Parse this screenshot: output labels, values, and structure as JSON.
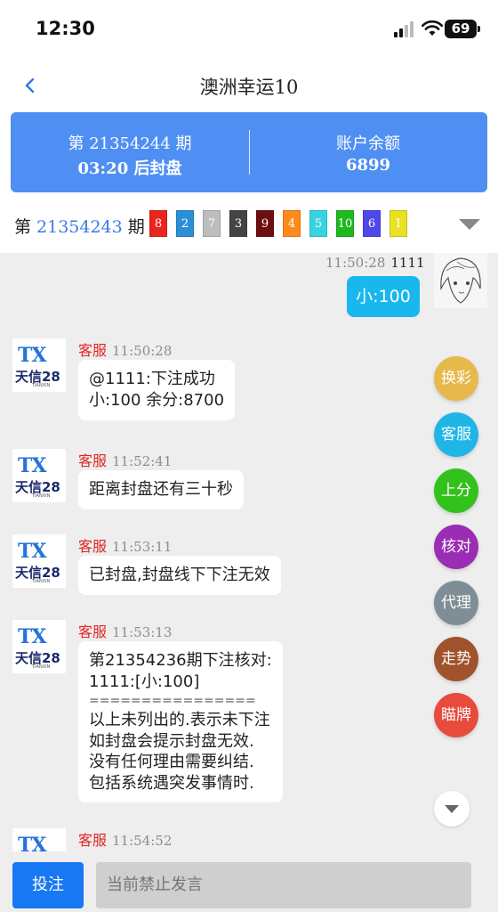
{
  "status": {
    "time": "12:30",
    "battery": "69"
  },
  "nav": {
    "title": "澳洲幸运10"
  },
  "info": {
    "period_label": "第 21354244 期",
    "countdown_label": "03:20 后封盘",
    "balance_title": "账户余额",
    "balance_value": "6899"
  },
  "result": {
    "prefix": "第",
    "period": "21354243",
    "suffix": "期",
    "balls": [
      {
        "n": "8",
        "color": "#e8261e"
      },
      {
        "n": "2",
        "color": "#2a8fd6"
      },
      {
        "n": "7",
        "color": "#bdbdbd"
      },
      {
        "n": "3",
        "color": "#444444"
      },
      {
        "n": "9",
        "color": "#6e0f0f"
      },
      {
        "n": "4",
        "color": "#ff8a1a"
      },
      {
        "n": "5",
        "color": "#38d3e0"
      },
      {
        "n": "10",
        "color": "#1fb81f"
      },
      {
        "n": "6",
        "color": "#4e47ea"
      },
      {
        "n": "1",
        "color": "#e9e223"
      }
    ]
  },
  "my_message": {
    "time": "11:50:28",
    "user": "1111",
    "text": "小:100"
  },
  "messages": [
    {
      "name": "客服",
      "time": "11:50:28",
      "lines": [
        "@1111:下注成功",
        "小:100 余分:8700"
      ]
    },
    {
      "name": "客服",
      "time": "11:52:41",
      "lines": [
        "距离封盘还有三十秒"
      ]
    },
    {
      "name": "客服",
      "time": "11:53:11",
      "lines": [
        "已封盘,封盘线下下注无效"
      ]
    },
    {
      "name": "客服",
      "time": "11:53:13",
      "lines": [
        "第21354236期下注核对:",
        "1111:[小:100]",
        "================",
        "以上未列出的.表示未下注",
        "如封盘会提示封盘无效.",
        "没有任何理由需要纠结.",
        "包括系统遇突发事情时."
      ]
    },
    {
      "name": "客服",
      "time": "11:54:52",
      "lines": []
    }
  ],
  "avatar_brand": {
    "logo": "TX",
    "name": "天信28",
    "sub": "TIANXIN"
  },
  "side_buttons": [
    {
      "label": "换彩",
      "color": "#e6b94a"
    },
    {
      "label": "客服",
      "color": "#1fb6e6"
    },
    {
      "label": "上分",
      "color": "#33c21c"
    },
    {
      "label": "核对",
      "color": "#9a2db3"
    },
    {
      "label": "代理",
      "color": "#7f8e96"
    },
    {
      "label": "走势",
      "color": "#a0522d"
    },
    {
      "label": "瞄牌",
      "color": "#e84a3c"
    }
  ],
  "bottom": {
    "bet_label": "投注",
    "input_placeholder": "当前禁止发言"
  }
}
